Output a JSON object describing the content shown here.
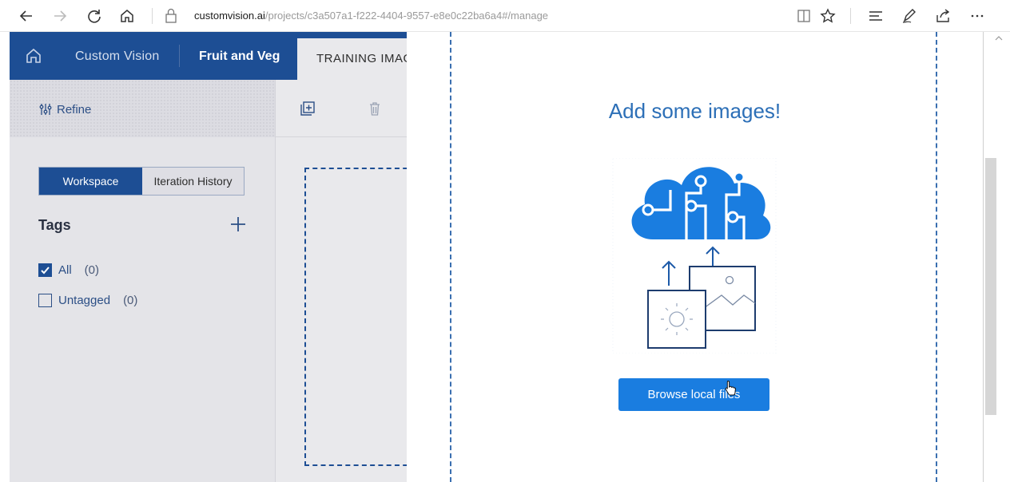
{
  "browser": {
    "url_host": "customvision.ai",
    "url_path": "/projects/c3a507a1-f222-4404-9557-e8e0c22ba6a4#/manage"
  },
  "app": {
    "name": "Custom Vision",
    "project": "Fruit and Veg",
    "active_tab": "TRAINING IMAGES",
    "refine_label": "Refine",
    "segment": {
      "workspace": "Workspace",
      "history": "Iteration History"
    },
    "tags_heading": "Tags",
    "tags": [
      {
        "label": "All",
        "count": "(0)",
        "checked": true
      },
      {
        "label": "Untagged",
        "count": "(0)",
        "checked": false
      }
    ]
  },
  "panel": {
    "title": "Add some images!",
    "browse_label": "Browse local files"
  },
  "colors": {
    "brand_dark": "#1d4e94",
    "accent": "#1a7de0"
  },
  "icons": [
    "back-icon",
    "forward-icon",
    "refresh-icon",
    "home-icon",
    "lock-icon",
    "reading-view-icon",
    "favorite-star-icon",
    "hub-icon",
    "pen-icon",
    "share-icon",
    "more-icon",
    "add-images-icon",
    "delete-icon",
    "plus-icon"
  ]
}
